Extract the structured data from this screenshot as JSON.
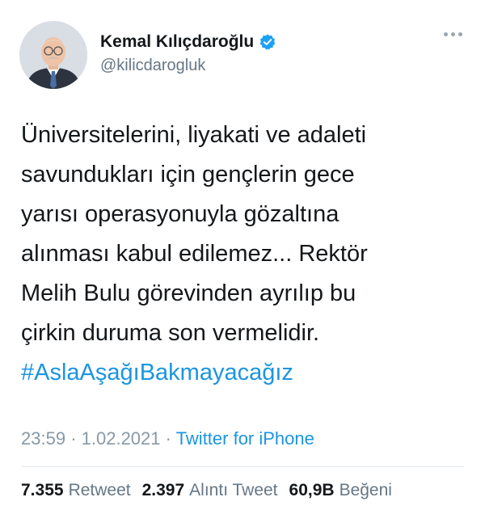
{
  "author": {
    "display_name": "Kemal Kılıçdaroğlu",
    "handle": "@kilicdarogluk",
    "verified": true
  },
  "tweet": {
    "lines": [
      "Üniversitelerini, liyakati ve adaleti",
      "savundukları için gençlerin gece",
      "yarısı operasyonuyla gözaltına",
      "alınması kabul edilemez... Rektör",
      "Melih Bulu görevinden ayrılıp bu",
      "çirkin duruma son vermelidir."
    ],
    "hashtag": "#AslaAşağıBakmayacağız"
  },
  "meta": {
    "time": "23:59",
    "separator": "·",
    "date": "1.02.2021",
    "source": "Twitter for iPhone"
  },
  "stats": {
    "retweets": {
      "count": "7.355",
      "label": "Retweet"
    },
    "quotes": {
      "count": "2.397",
      "label": "Alıntı Tweet"
    },
    "likes": {
      "count": "60,9B",
      "label": "Beğeni"
    }
  },
  "colors": {
    "link": "#1b95e0",
    "text": "#14171a",
    "secondary": "#657786",
    "verified_badge": "#1da1f2"
  },
  "icons": {
    "verified": "verified-badge-icon",
    "more": "more-options-icon"
  }
}
